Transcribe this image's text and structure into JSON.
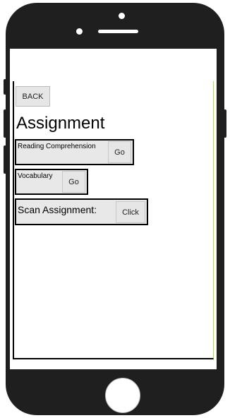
{
  "header": {
    "back_label": "BACK",
    "title": "Assignment"
  },
  "rows": [
    {
      "label": "Reading Comprehension",
      "button": "Go"
    },
    {
      "label": "Vocabulary",
      "button": "Go"
    },
    {
      "label": "Scan Assignment:",
      "button": "Click"
    }
  ]
}
